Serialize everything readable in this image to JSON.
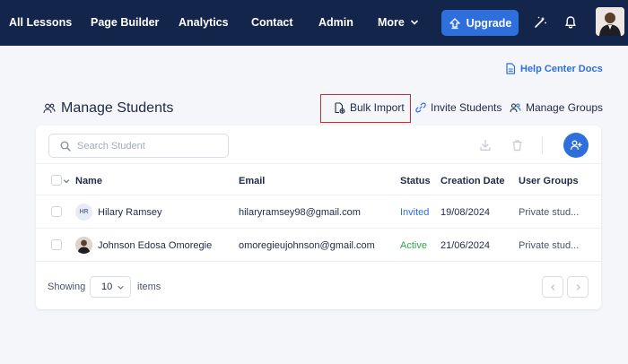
{
  "nav": {
    "items": [
      "All Lessons",
      "Page Builder",
      "Analytics",
      "Contact",
      "Admin"
    ],
    "more_label": "More",
    "upgrade_label": "Upgrade"
  },
  "help_link": "Help Center Docs",
  "page_title": "Manage Students",
  "actions": {
    "bulk_import": "Bulk Import",
    "invite": "Invite Students",
    "groups": "Manage Groups"
  },
  "search": {
    "placeholder": "Search Student",
    "value": ""
  },
  "table": {
    "columns": [
      "Name",
      "Email",
      "Status",
      "Creation Date",
      "User Groups"
    ],
    "rows": [
      {
        "initials": "HR",
        "name": "Hilary Ramsey",
        "email": "hilaryramsey98@gmail.com",
        "status": "Invited",
        "date": "19/08/2024",
        "groups": "Private stud..."
      },
      {
        "initials": "",
        "name": "Johnson Edosa Omoregie",
        "email": "omoregieujohnson@gmail.com",
        "status": "Active",
        "date": "21/06/2024",
        "groups": "Private stud..."
      }
    ]
  },
  "footer": {
    "showing_label": "Showing",
    "page_size": "10",
    "items_label": "items"
  },
  "colors": {
    "nav_bg": "#13254b",
    "accent": "#2e6fdc",
    "invited": "#2e6fdc",
    "active": "#2ea44f",
    "highlight_box": "#e02424"
  },
  "icons": [
    "arrow-up-icon",
    "chevron-down-icon",
    "magic-wand-icon",
    "bell-icon",
    "doc-icon",
    "users-icon",
    "import-icon",
    "link-icon",
    "group-icon",
    "search-icon",
    "download-icon",
    "trash-icon",
    "user-add-icon",
    "chevron-left-icon",
    "chevron-right-icon"
  ]
}
